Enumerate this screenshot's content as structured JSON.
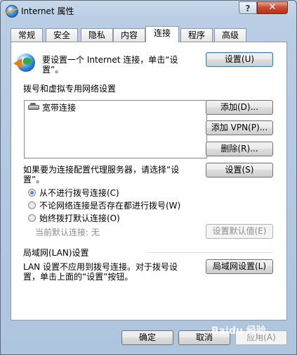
{
  "window": {
    "title": "Internet 属性",
    "help_label": "?",
    "close_label": "✕"
  },
  "tabs": [
    {
      "label": "常规",
      "active": false
    },
    {
      "label": "安全",
      "active": false
    },
    {
      "label": "隐私",
      "active": false
    },
    {
      "label": "内容",
      "active": false
    },
    {
      "label": "连接",
      "active": true
    },
    {
      "label": "程序",
      "active": false
    },
    {
      "label": "高级",
      "active": false
    }
  ],
  "setup": {
    "text_line1": "要设置一个 Internet 连接，单击“设",
    "text_line2": "置”。",
    "button": "设置(U)",
    "icon": "internet-globe-icon"
  },
  "dialup": {
    "heading": "拨号和虚拟专用网络设置",
    "connections": [
      {
        "name": "宽带连接",
        "icon": "modem-icon"
      }
    ],
    "add_button": "添加(D)...",
    "add_vpn_button": "添加 VPN(P)...",
    "remove_button": "删除(R)...",
    "proxy_text_line1": "如果要为连接配置代理服务器，请选择“设",
    "proxy_text_line2": "置”。",
    "settings_button": "设置(S)",
    "options": [
      {
        "label": "从不进行拨号连接(C)",
        "checked": true
      },
      {
        "label": "不论网络连接是否存在都进行拨号(W)",
        "checked": false
      },
      {
        "label": "始终拨打默认连接(O)",
        "checked": false
      }
    ],
    "current_default": "当前默认连接: 无",
    "set_default_button": "设置默认值(E)"
  },
  "lan": {
    "heading": "局域网(LAN)设置",
    "text_line1": "LAN 设置不应用到拨号连接。对于拨号设",
    "text_line2": "置，单击上面的“设置”按钮。",
    "button": "局域网设置(L)"
  },
  "footer": {
    "ok": "确定",
    "cancel": "取消",
    "apply": "应用(A)"
  },
  "watermark": "Baidu 经验"
}
